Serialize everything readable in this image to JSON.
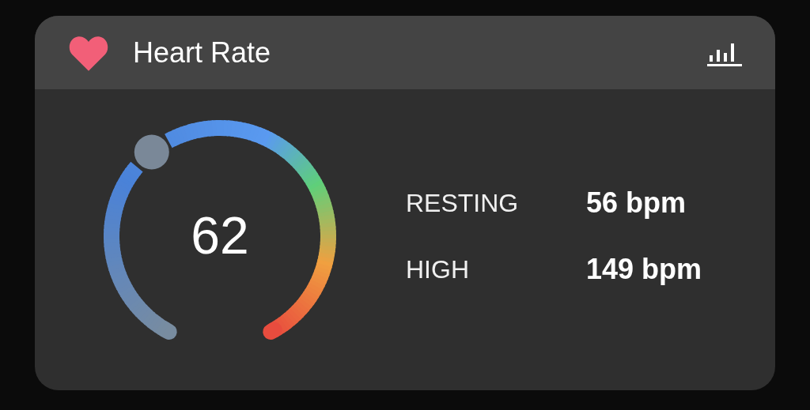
{
  "card": {
    "title": "Heart Rate"
  },
  "gauge": {
    "value": "62"
  },
  "stats": [
    {
      "label": "RESTING",
      "value": "56 bpm"
    },
    {
      "label": "HIGH",
      "value": "149 bpm"
    }
  ]
}
